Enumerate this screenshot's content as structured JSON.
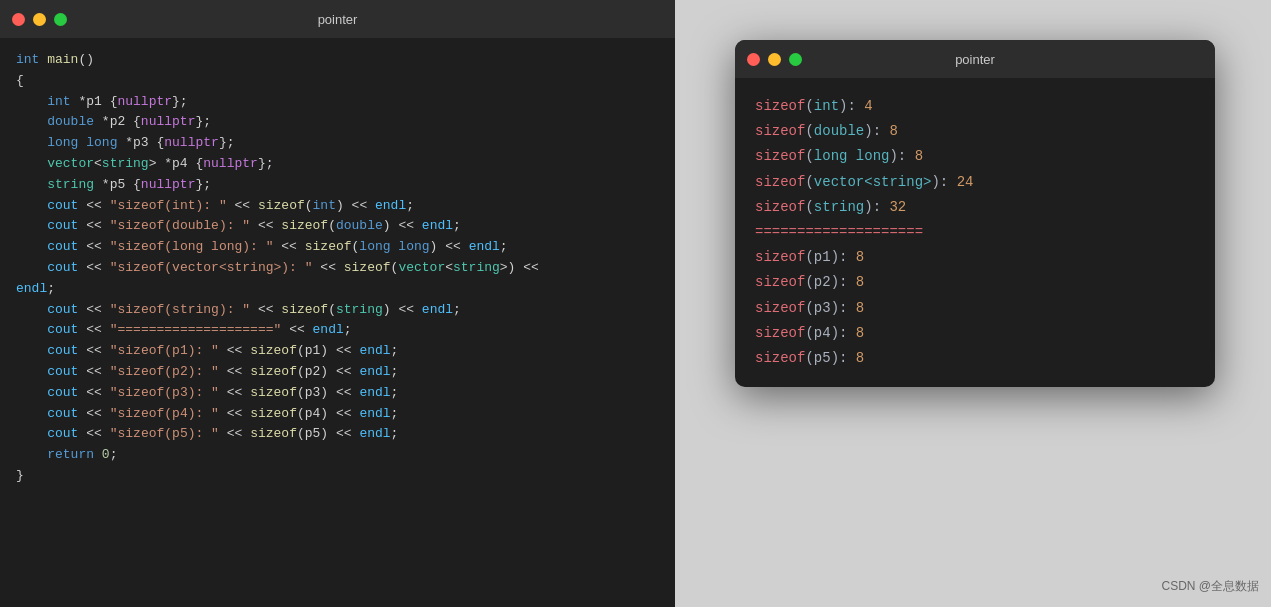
{
  "leftWindow": {
    "title": "pointer",
    "trafficLights": [
      "red",
      "yellow",
      "green"
    ]
  },
  "rightWindow": {
    "title": "pointer",
    "trafficLights": [
      "red",
      "yellow",
      "green"
    ]
  },
  "csdnBadge": "CSDN @全息数据"
}
